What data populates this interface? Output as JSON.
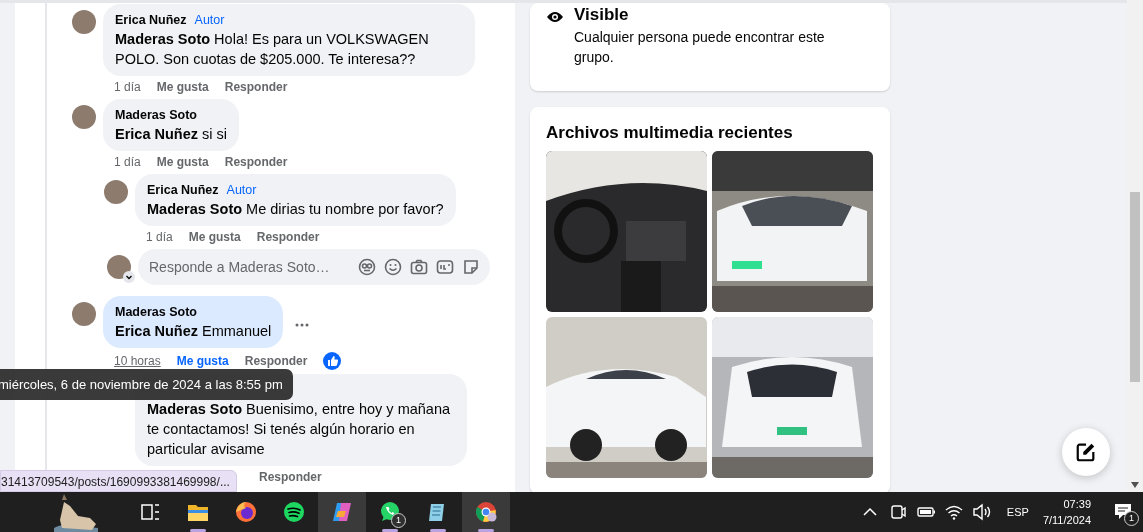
{
  "comments": [
    {
      "author": "Erica Nuñez",
      "author_badge": "Autor",
      "mention": "Maderas Soto",
      "text": "Hola! Es para un VOLKSWAGEN POLO. Son cuotas de $205.000. Te interesa??",
      "time": "1 día",
      "like_label": "Me gusta",
      "reply_label": "Responder",
      "liked": false,
      "highlighted": false
    },
    {
      "author": "Maderas Soto",
      "mention": "Erica Nuñez",
      "text": "si si",
      "time": "1 día",
      "like_label": "Me gusta",
      "reply_label": "Responder",
      "liked": false,
      "highlighted": false,
      "children": [
        {
          "author": "Erica Nuñez",
          "author_badge": "Autor",
          "mention": "Maderas Soto",
          "text": "Me dirias tu nombre por favor?",
          "time": "1 día",
          "like_label": "Me gusta",
          "reply_label": "Responder",
          "liked": false,
          "highlighted": false
        }
      ],
      "reply_box": {
        "placeholder": "Responde a Maderas Soto…"
      }
    },
    {
      "author": "Maderas Soto",
      "mention": "Erica Nuñez",
      "text": "Emmanuel",
      "time": "10 horas",
      "time_hovered": true,
      "like_label": "Me gusta",
      "reply_label": "Responder",
      "liked": true,
      "has_reaction": true,
      "highlighted": true,
      "more_menu": true,
      "children": [
        {
          "mention": "Maderas Soto",
          "text": "Buenisimo, entre hoy y mañana te contactamos! Si tenés algún horario en particular avisame",
          "reply_label": "Responder",
          "highlighted": false
        }
      ]
    }
  ],
  "tooltip": {
    "text": "miércoles, 6 de noviembre de 2024 a las 8:55 pm"
  },
  "status_url": {
    "text": "31413709543/posts/1690993381469998/..."
  },
  "about_card": {
    "title": "Visible",
    "description": "Cualquier persona puede encontrar este grupo."
  },
  "media_card": {
    "title": "Archivos multimedia recientes",
    "photos": [
      {
        "kind": "interior"
      },
      {
        "kind": "front"
      },
      {
        "kind": "side"
      },
      {
        "kind": "rear"
      }
    ]
  },
  "taskbar": {
    "apps": [
      {
        "kind": "widget",
        "running": false,
        "highlighted": false
      },
      {
        "kind": "taskview",
        "running": false,
        "highlighted": false
      },
      {
        "kind": "explorer",
        "running": true,
        "highlighted": false
      },
      {
        "kind": "firefox",
        "running": false,
        "highlighted": false
      },
      {
        "kind": "spotify",
        "running": false,
        "highlighted": false
      },
      {
        "kind": "copilot",
        "running": false,
        "highlighted": true
      },
      {
        "kind": "whatsapp",
        "running": true,
        "highlighted": false,
        "badge": "1"
      },
      {
        "kind": "notepad",
        "running": true,
        "highlighted": false
      },
      {
        "kind": "chrome",
        "running": true,
        "highlighted": true
      }
    ],
    "tray_icons": [
      {
        "kind": "chevron"
      },
      {
        "kind": "meet"
      },
      {
        "kind": "battery"
      },
      {
        "kind": "wifi"
      },
      {
        "kind": "volume"
      }
    ],
    "language": "ESP",
    "time": "07:39",
    "date": "7/11/2024",
    "notification_badge": "1"
  }
}
